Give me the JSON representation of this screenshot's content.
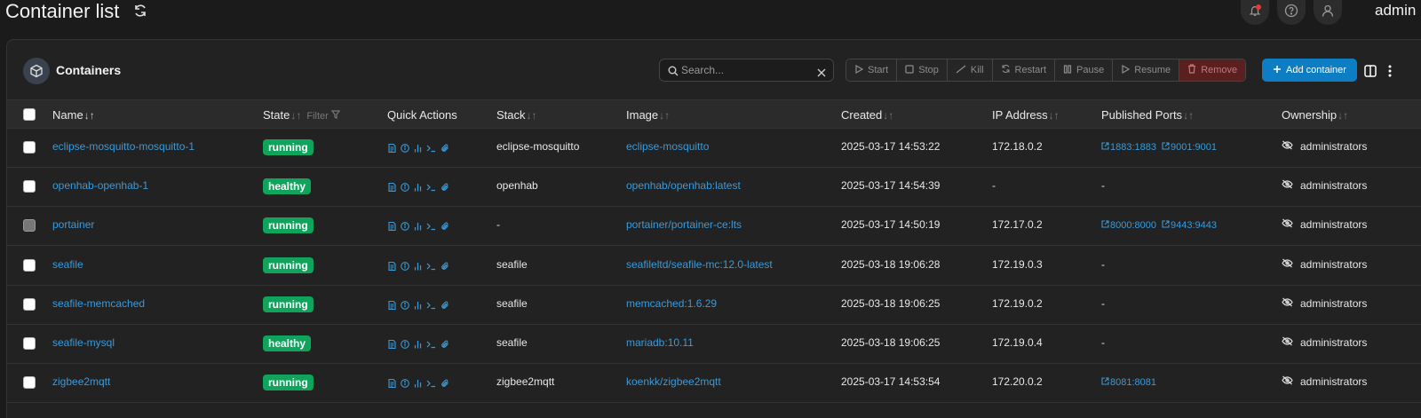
{
  "header": {
    "title": "Container list",
    "user": "admin"
  },
  "panel": {
    "title": "Containers",
    "search_placeholder": "Search...",
    "actions": [
      {
        "label": "Start",
        "icon": "play-icon"
      },
      {
        "label": "Stop",
        "icon": "stop-icon"
      },
      {
        "label": "Kill",
        "icon": "slash-icon"
      },
      {
        "label": "Restart",
        "icon": "refresh-icon"
      },
      {
        "label": "Pause",
        "icon": "pause-icon"
      },
      {
        "label": "Resume",
        "icon": "play-icon"
      },
      {
        "label": "Remove",
        "icon": "trash-icon"
      }
    ],
    "add_label": "Add container"
  },
  "columns": {
    "name": "Name",
    "state": "State",
    "filter": "Filter",
    "quick_actions": "Quick Actions",
    "stack": "Stack",
    "image": "Image",
    "created": "Created",
    "ip": "IP Address",
    "ports": "Published Ports",
    "ownership": "Ownership"
  },
  "rows": [
    {
      "name": "eclipse-mosquitto-mosquitto-1",
      "state": "running",
      "stack": "eclipse-mosquitto",
      "image": "eclipse-mosquitto",
      "created": "2025-03-17 14:53:22",
      "ip": "172.18.0.2",
      "ports": [
        "1883:1883",
        "9001:9001"
      ],
      "ownership": "administrators"
    },
    {
      "name": "openhab-openhab-1",
      "state": "healthy",
      "stack": "openhab",
      "image": "openhab/openhab:latest",
      "created": "2025-03-17 14:54:39",
      "ip": "-",
      "ports": [],
      "ownership": "administrators"
    },
    {
      "name": "portainer",
      "state": "running",
      "stack": "-",
      "image": "portainer/portainer-ce:lts",
      "created": "2025-03-17 14:50:19",
      "ip": "172.17.0.2",
      "ports": [
        "8000:8000",
        "9443:9443"
      ],
      "ownership": "administrators"
    },
    {
      "name": "seafile",
      "state": "running",
      "stack": "seafile",
      "image": "seafileltd/seafile-mc:12.0-latest",
      "created": "2025-03-18 19:06:28",
      "ip": "172.19.0.3",
      "ports": [],
      "ownership": "administrators"
    },
    {
      "name": "seafile-memcached",
      "state": "running",
      "stack": "seafile",
      "image": "memcached:1.6.29",
      "created": "2025-03-18 19:06:25",
      "ip": "172.19.0.2",
      "ports": [],
      "ownership": "administrators"
    },
    {
      "name": "seafile-mysql",
      "state": "healthy",
      "stack": "seafile",
      "image": "mariadb:10.11",
      "created": "2025-03-18 19:06:25",
      "ip": "172.19.0.4",
      "ports": [],
      "ownership": "administrators"
    },
    {
      "name": "zigbee2mqtt",
      "state": "running",
      "stack": "zigbee2mqtt",
      "image": "koenkk/zigbee2mqtt",
      "created": "2025-03-17 14:53:54",
      "ip": "172.20.0.2",
      "ports": [
        "8081:8081"
      ],
      "ownership": "administrators"
    }
  ],
  "empty_ports": "-",
  "colors": {
    "accent": "#0d7ec4",
    "badge": "#0fa35c",
    "link": "#3a9ad9"
  }
}
